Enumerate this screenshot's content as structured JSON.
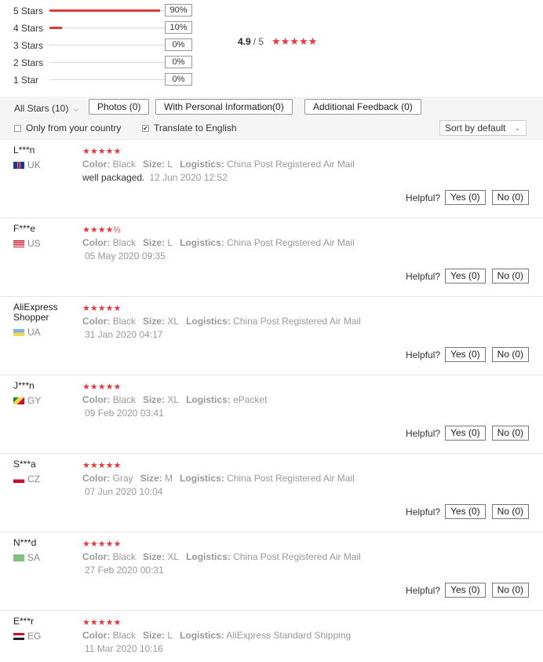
{
  "histogram": [
    {
      "label": "5 Stars",
      "percent": "90%",
      "fill": 0.9
    },
    {
      "label": "4 Stars",
      "percent": "10%",
      "fill": 0.1
    },
    {
      "label": "3 Stars",
      "percent": "0%",
      "fill": 0
    },
    {
      "label": "2 Stars",
      "percent": "0%",
      "fill": 0
    },
    {
      "label": "1 Star",
      "percent": "0%",
      "fill": 0
    }
  ],
  "overall": {
    "average": "4.9",
    "out_of": "/ 5",
    "stars": "★★★★★"
  },
  "filters": {
    "all_stars": "All Stars (10)",
    "photos": "Photos (0)",
    "personal_info": "With Personal Information(0)",
    "additional_feedback": "Additional Feedback (0)",
    "only_country": "Only from your country",
    "translate": "Translate to English",
    "sort": "Sort by default"
  },
  "labels": {
    "color": "Color:",
    "size": "Size:",
    "logistics": "Logistics:",
    "helpful": "Helpful?"
  },
  "reviews": [
    {
      "name": "L***n",
      "country": "UK",
      "stars": "★★★★★",
      "color": "Black",
      "size": "L",
      "logistics": "China Post Registered Air Mail",
      "text": "well packaged.",
      "date": "12 Jun 2020 12:52",
      "yes": "Yes (0)",
      "no": "No (0)"
    },
    {
      "name": "F***e",
      "country": "US",
      "stars": "★★★★½",
      "rating": 4.5,
      "color": "Black",
      "size": "L",
      "logistics": "China Post Registered Air Mail",
      "text": "",
      "date": "05 May 2020 09:35",
      "yes": "Yes (0)",
      "no": "No (0)"
    },
    {
      "name": "AliExpress Shopper",
      "country": "UA",
      "stars": "★★★★★",
      "color": "Black",
      "size": "XL",
      "logistics": "China Post Registered Air Mail",
      "text": "",
      "date": "31 Jan 2020 04:17",
      "yes": "Yes (0)",
      "no": "No (0)"
    },
    {
      "name": "J***n",
      "country": "GY",
      "stars": "★★★★★",
      "color": "Black",
      "size": "XL",
      "logistics": "ePacket",
      "text": "",
      "date": "09 Feb 2020 03:41",
      "yes": "Yes (0)",
      "no": "No (0)"
    },
    {
      "name": "S***a",
      "country": "CZ",
      "stars": "★★★★★",
      "color": "Gray",
      "size": "M",
      "logistics": "China Post Registered Air Mail",
      "text": "",
      "date": "07 Jun 2020 10:04",
      "yes": "Yes (0)",
      "no": "No (0)"
    },
    {
      "name": "N***d",
      "country": "SA",
      "stars": "★★★★★",
      "color": "Black",
      "size": "XL",
      "logistics": "China Post Registered Air Mail",
      "text": "",
      "date": "27 Feb 2020 00:31",
      "yes": "Yes (0)",
      "no": "No (0)"
    },
    {
      "name": "E***r",
      "country": "EG",
      "stars": "★★★★★",
      "color": "Black",
      "size": "L",
      "logistics": "AliExpress Standard Shipping",
      "text": "",
      "date": "11 Mar 2020 10:16",
      "yes": "",
      "no": ""
    }
  ]
}
